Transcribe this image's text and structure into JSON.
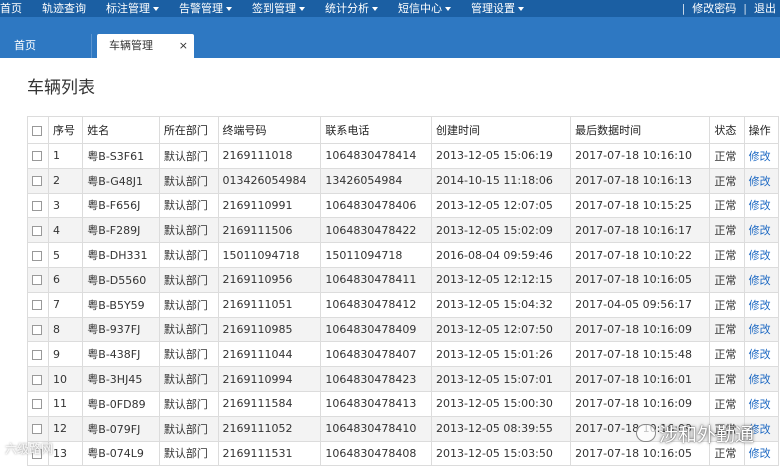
{
  "nav": {
    "items": [
      {
        "label": "首页",
        "caret": false
      },
      {
        "label": "轨迹查询",
        "caret": false
      },
      {
        "label": "标注管理",
        "caret": true
      },
      {
        "label": "告警管理",
        "caret": true
      },
      {
        "label": "签到管理",
        "caret": true
      },
      {
        "label": "统计分析",
        "caret": true
      },
      {
        "label": "短信中心",
        "caret": true
      },
      {
        "label": "管理设置",
        "caret": true
      }
    ],
    "change_password": "修改密码",
    "logout": "退出"
  },
  "tabs": {
    "home": "首页",
    "active": "车辆管理",
    "close": "×"
  },
  "page_title": "车辆列表",
  "table": {
    "headers": [
      "序号",
      "姓名",
      "所在部门",
      "终端号码",
      "联系电话",
      "创建时间",
      "最后数据时间",
      "状态",
      "操作"
    ],
    "rows": [
      [
        "1",
        "粤B-S3F61",
        "默认部门",
        "2169111018",
        "1064830478414",
        "2013-12-05 15:06:19",
        "2017-07-18 10:16:10",
        "正常",
        "修改"
      ],
      [
        "2",
        "粤B-G48J1",
        "默认部门",
        "013426054984",
        "13426054984",
        "2014-10-15 11:18:06",
        "2017-07-18 10:16:13",
        "正常",
        "修改"
      ],
      [
        "3",
        "粤B-F656J",
        "默认部门",
        "2169110991",
        "1064830478406",
        "2013-12-05 12:07:05",
        "2017-07-18 10:15:25",
        "正常",
        "修改"
      ],
      [
        "4",
        "粤B-F289J",
        "默认部门",
        "2169111506",
        "1064830478422",
        "2013-12-05 15:02:09",
        "2017-07-18 10:16:17",
        "正常",
        "修改"
      ],
      [
        "5",
        "粤B-DH331",
        "默认部门",
        "15011094718",
        "15011094718",
        "2016-08-04 09:59:46",
        "2017-07-18 10:10:22",
        "正常",
        "修改"
      ],
      [
        "6",
        "粤B-D5560",
        "默认部门",
        "2169110956",
        "1064830478411",
        "2013-12-05 12:12:15",
        "2017-07-18 10:16:05",
        "正常",
        "修改"
      ],
      [
        "7",
        "粤B-B5Y59",
        "默认部门",
        "2169111051",
        "1064830478412",
        "2013-12-05 15:04:32",
        "2017-04-05 09:56:17",
        "正常",
        "修改"
      ],
      [
        "8",
        "粤B-937FJ",
        "默认部门",
        "2169110985",
        "1064830478409",
        "2013-12-05 12:07:50",
        "2017-07-18 10:16:09",
        "正常",
        "修改"
      ],
      [
        "9",
        "粤B-438FJ",
        "默认部门",
        "2169111044",
        "1064830478407",
        "2013-12-05 15:01:26",
        "2017-07-18 10:15:48",
        "正常",
        "修改"
      ],
      [
        "10",
        "粤B-3HJ45",
        "默认部门",
        "2169110994",
        "1064830478423",
        "2013-12-05 15:07:01",
        "2017-07-18 10:16:01",
        "正常",
        "修改"
      ],
      [
        "11",
        "粤B-0FD89",
        "默认部门",
        "2169111584",
        "1064830478413",
        "2013-12-05 15:00:30",
        "2017-07-18 10:16:09",
        "正常",
        "修改"
      ],
      [
        "12",
        "粤B-079FJ",
        "默认部门",
        "2169111052",
        "1064830478410",
        "2013-12-05 08:39:55",
        "2017-07-18 10:16:09",
        "正常",
        "修改"
      ],
      [
        "13",
        "粤B-074L9",
        "默认部门",
        "2169111531",
        "1064830478408",
        "2013-12-05 15:03:50",
        "2017-07-18 10:16:05",
        "正常",
        "修改"
      ]
    ]
  },
  "watermarks": {
    "left": "六级路网",
    "right": "涉和外勤通"
  }
}
